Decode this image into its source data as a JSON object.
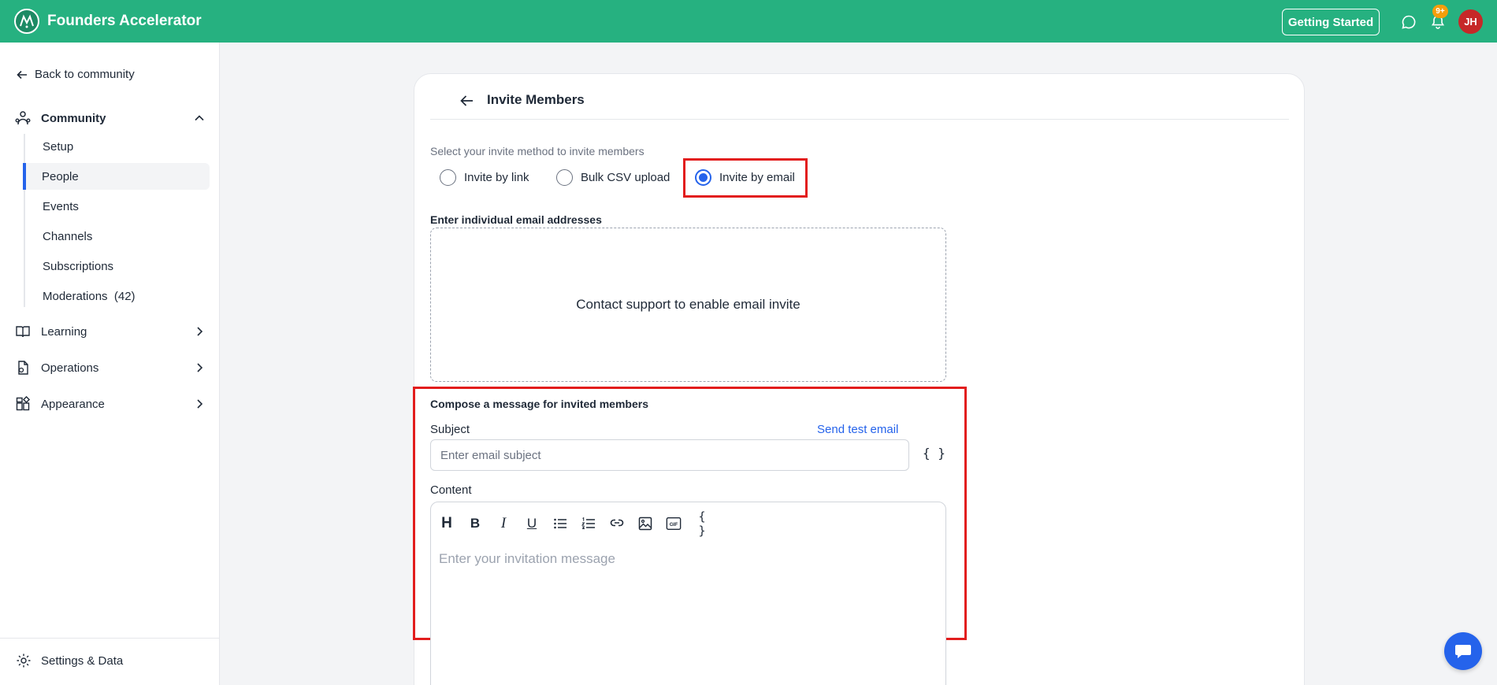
{
  "colors": {
    "topbar": "#26b180",
    "accent": "#2563eb",
    "highlight": "#e21d1d",
    "avatar": "#c62828",
    "badge": "#f59e0b"
  },
  "header": {
    "brand": "Founders Accelerator",
    "getting_started": "Getting Started",
    "notification_count": "9+",
    "avatar_initials": "JH",
    "icons": [
      "logo-icon",
      "chat-bubble-icon",
      "bell-icon"
    ]
  },
  "sidebar": {
    "back_label": "Back to community",
    "community": {
      "label": "Community",
      "items": [
        {
          "label": "Setup"
        },
        {
          "label": "People"
        },
        {
          "label": "Events"
        },
        {
          "label": "Channels"
        },
        {
          "label": "Subscriptions"
        },
        {
          "label": "Moderations  (42)"
        }
      ]
    },
    "sections": [
      {
        "label": "Learning",
        "icon": "book-icon"
      },
      {
        "label": "Operations",
        "icon": "file-icon"
      },
      {
        "label": "Appearance",
        "icon": "layout-icon"
      }
    ],
    "settings_label": "Settings & Data"
  },
  "invite": {
    "title": "Invite Members",
    "method_prompt": "Select your invite method to invite members",
    "methods": [
      {
        "label": "Invite by link",
        "selected": false
      },
      {
        "label": "Bulk CSV upload",
        "selected": false
      },
      {
        "label": "Invite by email",
        "selected": true
      }
    ],
    "emails_label": "Enter individual email addresses",
    "emails_notice": "Contact support to enable email invite"
  },
  "compose": {
    "title": "Compose a message for invited members",
    "subject_label": "Subject",
    "send_test": "Send test email",
    "subject_placeholder": "Enter email subject",
    "subject_value": "",
    "variable_button": "{ }",
    "content_label": "Content",
    "toolbar": {
      "heading": "H",
      "bold": "B",
      "italic": "I",
      "underline": "U",
      "gif": "GIF",
      "variables": "{ }"
    },
    "content_placeholder": "Enter your invitation message"
  }
}
